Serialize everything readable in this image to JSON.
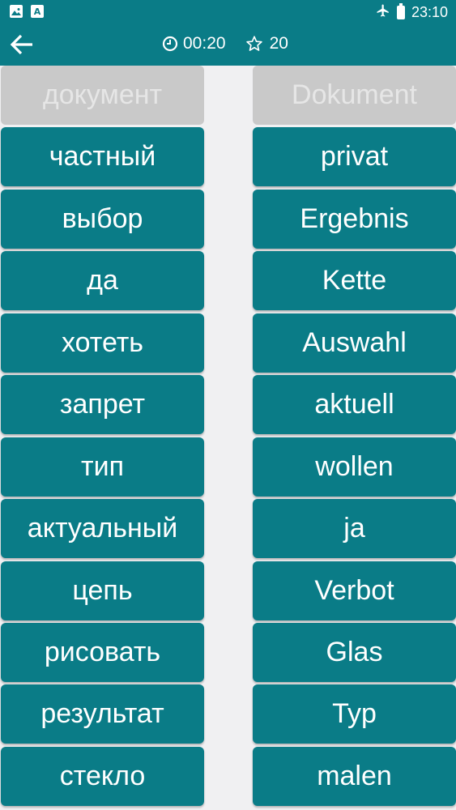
{
  "status_bar": {
    "time": "23:10",
    "icons": [
      "image-icon",
      "text-a-icon",
      "airplane-icon",
      "battery-icon"
    ],
    "a_icon_label": "A"
  },
  "app_bar": {
    "timer": "00:20",
    "score": "20",
    "icons": [
      "back-arrow-icon",
      "clock-icon",
      "star-icon"
    ]
  },
  "colors": {
    "teal": "#0a7c87",
    "matched_tile": "#c9c9c9",
    "background": "#f0f0f2"
  },
  "left_words": [
    "документ",
    "частный",
    "выбор",
    "да",
    "хотеть",
    "запрет",
    "тип",
    "актуальный",
    "цепь",
    "рисовать",
    "результат",
    "стекло"
  ],
  "right_words": [
    "Dokument",
    "privat",
    "Ergebnis",
    "Kette",
    "Auswahl",
    "aktuell",
    "wollen",
    "ja",
    "Verbot",
    "Glas",
    "Typ",
    "malen"
  ]
}
